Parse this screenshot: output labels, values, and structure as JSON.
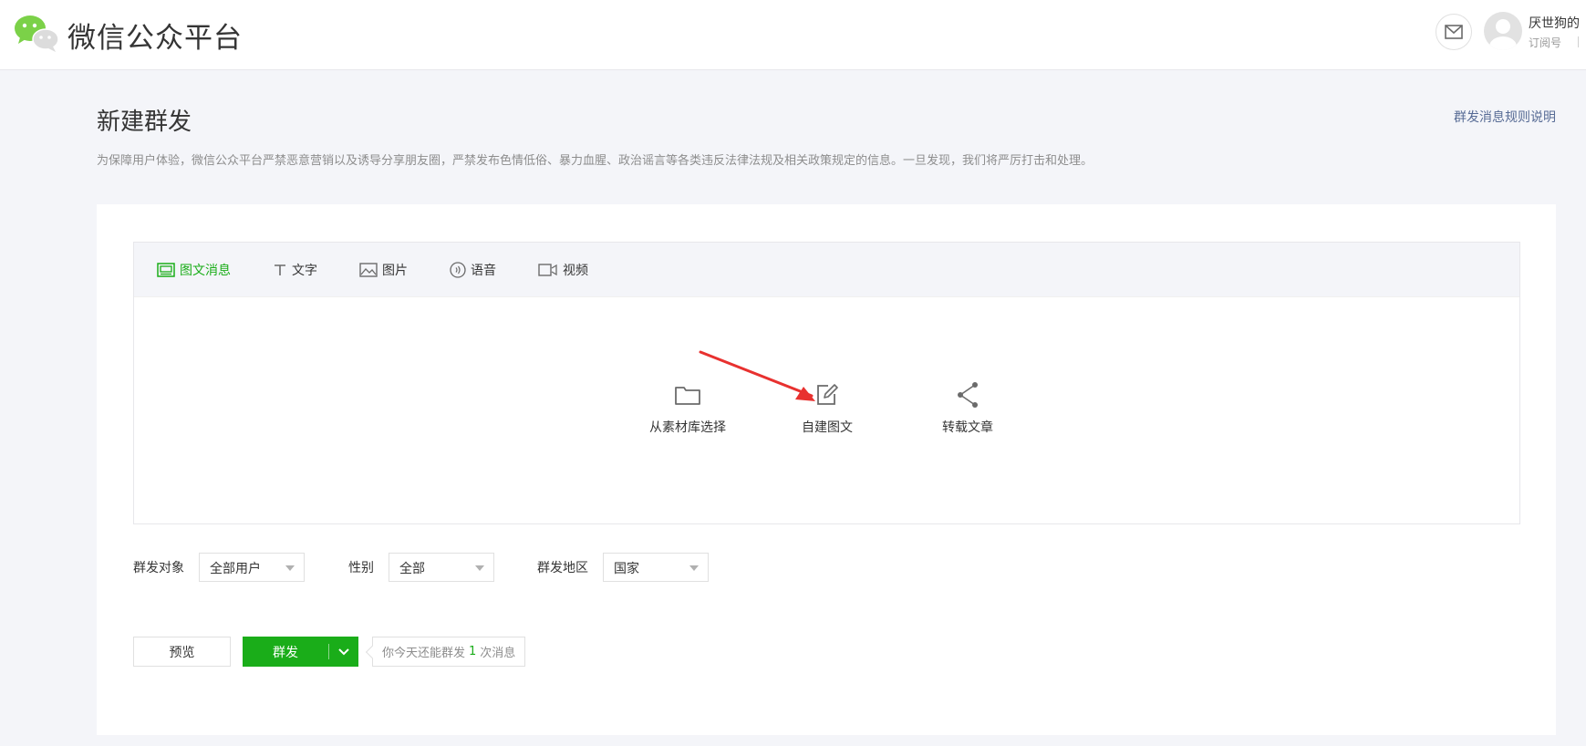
{
  "header": {
    "brand": "微信公众平台",
    "account_name": "厌世狗的",
    "account_type": "订阅号"
  },
  "page": {
    "title": "新建群发",
    "rules_link": "群发消息规则说明",
    "notice": "为保障用户体验，微信公众平台严禁恶意营销以及诱导分享朋友圈，严禁发布色情低俗、暴力血腥、政治谣言等各类违反法律法规及相关政策规定的信息。一旦发现，我们将严厉打击和处理。"
  },
  "tabs": [
    {
      "label": "图文消息",
      "icon": "news-icon",
      "active": true
    },
    {
      "label": "文字",
      "icon": "text-icon",
      "active": false
    },
    {
      "label": "图片",
      "icon": "image-icon",
      "active": false
    },
    {
      "label": "语音",
      "icon": "voice-icon",
      "active": false
    },
    {
      "label": "视频",
      "icon": "video-icon",
      "active": false
    }
  ],
  "options": [
    {
      "label": "从素材库选择",
      "icon": "folder-icon"
    },
    {
      "label": "自建图文",
      "icon": "edit-icon"
    },
    {
      "label": "转载文章",
      "icon": "share-icon"
    }
  ],
  "filters": {
    "target_label": "群发对象",
    "target_value": "全部用户",
    "gender_label": "性别",
    "gender_value": "全部",
    "region_label": "群发地区",
    "region_value": "国家"
  },
  "actions": {
    "preview": "预览",
    "send": "群发",
    "quota_prefix": "你今天还能群发",
    "quota_count": "1",
    "quota_suffix": "次消息"
  },
  "colors": {
    "accent": "#1aad19",
    "link": "#576b95",
    "annotation_arrow": "#e8312f"
  }
}
